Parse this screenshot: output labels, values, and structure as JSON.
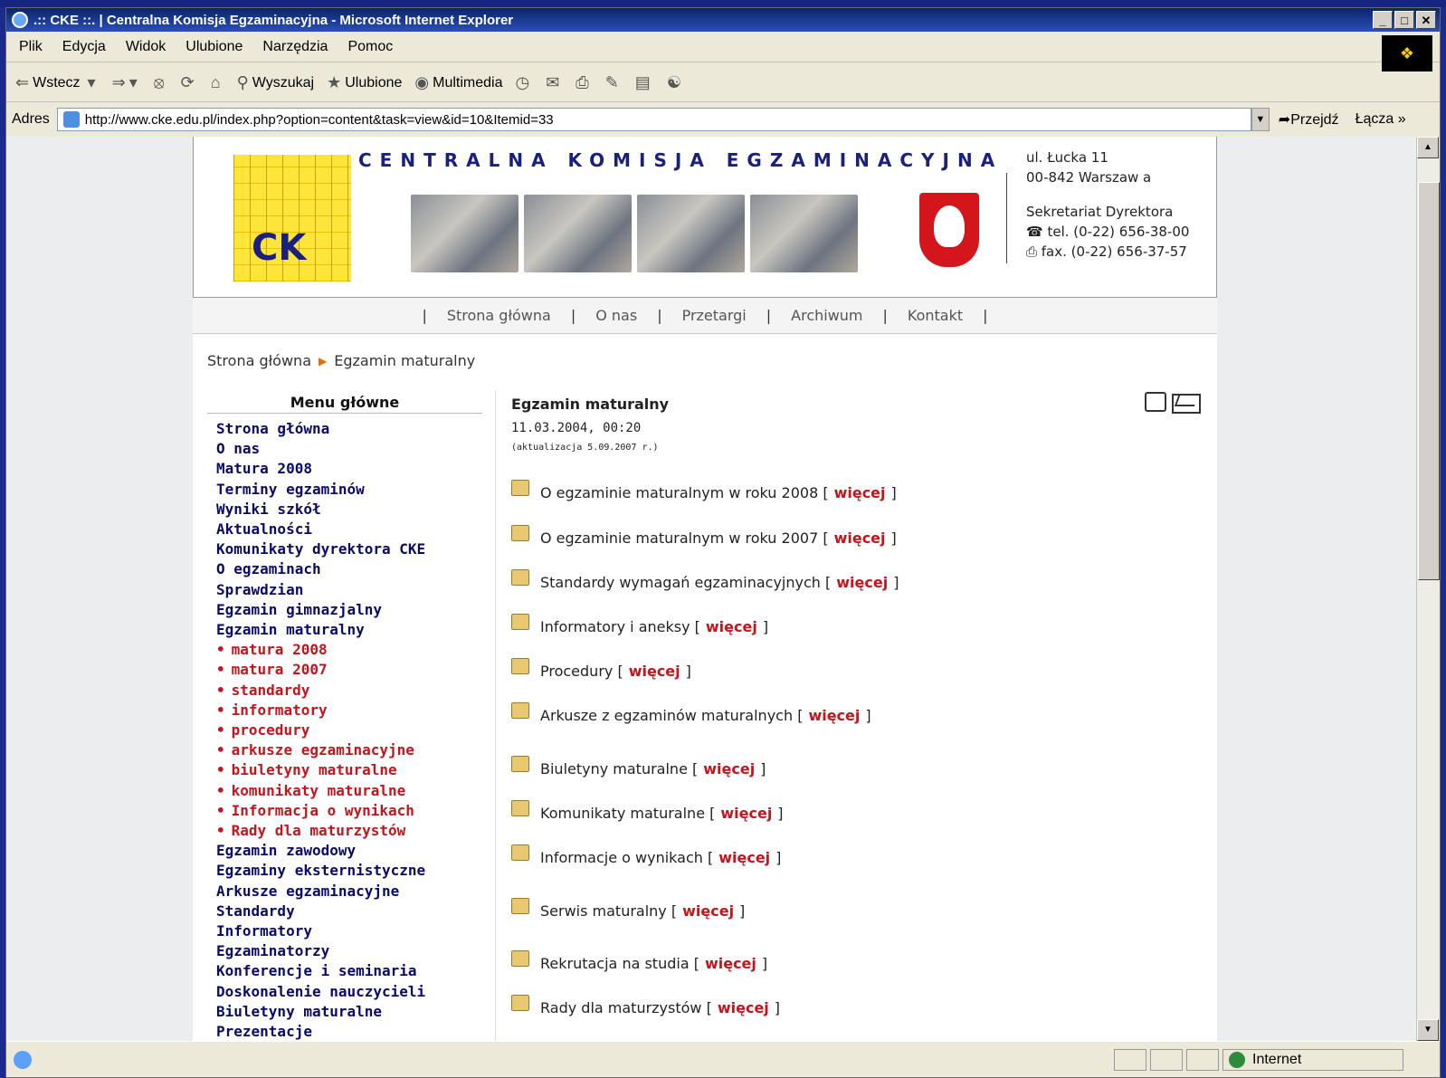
{
  "window": {
    "title": ".:: CKE ::. | Centralna Komisja Egzaminacyjna - Microsoft Internet Explorer"
  },
  "menubar": [
    "Plik",
    "Edycja",
    "Widok",
    "Ulubione",
    "Narzędzia",
    "Pomoc"
  ],
  "toolbar": {
    "back": "Wstecz",
    "search": "Wyszukaj",
    "favorites": "Ulubione",
    "media": "Multimedia"
  },
  "addressbar": {
    "label": "Adres",
    "url": "http://www.cke.edu.pl/index.php?option=content&task=view&id=10&Itemid=33",
    "go": "Przejdź",
    "links": "Łącza"
  },
  "status": {
    "zone": "Internet"
  },
  "site": {
    "org_name": "CENTRALNA KOMISJA EGZAMINACYJNA",
    "logo_text": "CK",
    "contact": {
      "street": "ul. Łucka 11",
      "city": "00-842 Warszaw a",
      "office": "Sekretariat Dyrektora",
      "tel": "tel. (0-22) 656-38-00",
      "fax": "fax. (0-22) 656-37-57"
    },
    "nav": [
      "Strona główna",
      "O nas",
      "Przetargi",
      "Archiwum",
      "Kontakt"
    ],
    "breadcrumb": {
      "home": "Strona główna",
      "current": "Egzamin maturalny"
    },
    "menu_title": "Menu główne",
    "menu_items": [
      {
        "label": "Strona główna",
        "sub": false
      },
      {
        "label": "O nas",
        "sub": false
      },
      {
        "label": "Matura 2008",
        "sub": false
      },
      {
        "label": "Terminy egzaminów",
        "sub": false
      },
      {
        "label": "Wyniki szkół",
        "sub": false
      },
      {
        "label": "Aktualności",
        "sub": false
      },
      {
        "label": "Komunikaty dyrektora CKE",
        "sub": false
      },
      {
        "label": "O egzaminach",
        "sub": false
      },
      {
        "label": "Sprawdzian",
        "sub": false
      },
      {
        "label": "Egzamin gimnazjalny",
        "sub": false
      },
      {
        "label": "Egzamin maturalny",
        "sub": false
      },
      {
        "label": "matura 2008",
        "sub": true
      },
      {
        "label": "matura 2007",
        "sub": true
      },
      {
        "label": "standardy",
        "sub": true
      },
      {
        "label": "informatory",
        "sub": true
      },
      {
        "label": "procedury",
        "sub": true
      },
      {
        "label": "arkusze egzaminacyjne",
        "sub": true
      },
      {
        "label": "biuletyny maturalne",
        "sub": true
      },
      {
        "label": "komunikaty maturalne",
        "sub": true
      },
      {
        "label": "Informacja o wynikach",
        "sub": true
      },
      {
        "label": "Rady dla maturzystów",
        "sub": true
      },
      {
        "label": "Egzamin zawodowy",
        "sub": false
      },
      {
        "label": "Egzaminy eksternistyczne",
        "sub": false
      },
      {
        "label": "Arkusze egzaminacyjne",
        "sub": false
      },
      {
        "label": "Standardy",
        "sub": false
      },
      {
        "label": "Informatory",
        "sub": false
      },
      {
        "label": "Egzaminatorzy",
        "sub": false
      },
      {
        "label": "Konferencje i seminaria",
        "sub": false
      },
      {
        "label": "Doskonalenie nauczycieli",
        "sub": false
      },
      {
        "label": "Biuletyny maturalne",
        "sub": false
      },
      {
        "label": "Prezentacje",
        "sub": false
      }
    ],
    "article": {
      "title": "Egzamin maturalny",
      "date": "11.03.2004, 00:20",
      "updated": "(aktualizacja 5.09.2007 r.)"
    },
    "more_label": "więcej",
    "links": [
      "O egzaminie maturalnym w roku 2008",
      "O egzaminie maturalnym w roku 2007",
      "Standardy wymagań egzaminacyjnych",
      "Informatory i aneksy",
      "Procedury",
      "Arkusze z egzaminów maturalnych",
      "Biuletyny maturalne",
      "Komunikaty maturalne",
      "Informacje o wynikach",
      "Serwis maturalny",
      "Rekrutacja na studia",
      "Rady dla maturzystów"
    ]
  }
}
